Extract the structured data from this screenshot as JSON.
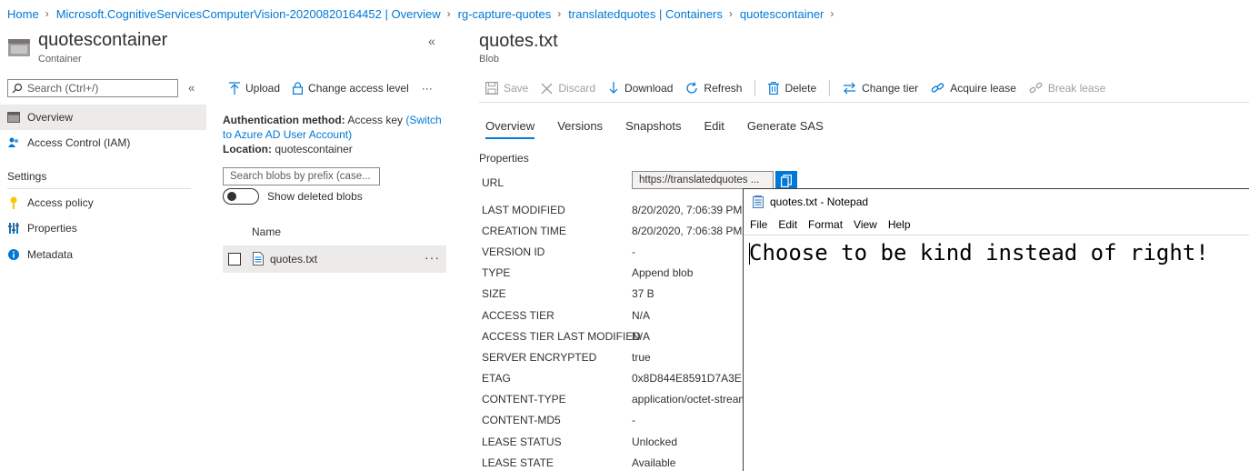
{
  "breadcrumb": [
    "Home",
    "Microsoft.CognitiveServicesComputerVision-20200820164452 | Overview",
    "rg-capture-quotes",
    "translatedquotes | Containers",
    "quotescontainer"
  ],
  "container": {
    "title": "quotescontainer",
    "subtitle": "Container"
  },
  "left_nav": {
    "search_placeholder": "Search (Ctrl+/)",
    "items": [
      {
        "label": "Overview",
        "icon": "overview-icon"
      },
      {
        "label": "Access Control (IAM)",
        "icon": "people-icon"
      }
    ],
    "settings_heading": "Settings",
    "settings_items": [
      {
        "label": "Access policy",
        "icon": "key-icon"
      },
      {
        "label": "Properties",
        "icon": "sliders-icon"
      },
      {
        "label": "Metadata",
        "icon": "info-icon"
      }
    ]
  },
  "middle": {
    "toolbar": {
      "upload": "Upload",
      "change_access": "Change access level",
      "more": "···"
    },
    "auth_label": "Authentication method:",
    "auth_value": "Access key",
    "auth_link": "(Switch to Azure AD User Account)",
    "location_label": "Location:",
    "location_value": "quotescontainer",
    "prefix_placeholder": "Search blobs by prefix (case...",
    "show_deleted": "Show deleted blobs",
    "name_header": "Name",
    "rows": [
      {
        "name": "quotes.txt"
      }
    ]
  },
  "blob": {
    "title": "quotes.txt",
    "subtitle": "Blob",
    "toolbar": {
      "save": "Save",
      "discard": "Discard",
      "download": "Download",
      "refresh": "Refresh",
      "delete": "Delete",
      "change_tier": "Change tier",
      "acquire_lease": "Acquire lease",
      "break_lease": "Break lease"
    },
    "tabs": [
      "Overview",
      "Versions",
      "Snapshots",
      "Edit",
      "Generate SAS"
    ],
    "properties_heading": "Properties",
    "url_label": "URL",
    "url_value": "https://translatedquotes ...",
    "properties": [
      {
        "label": "LAST MODIFIED",
        "value": "8/20/2020, 7:06:39 PM"
      },
      {
        "label": "CREATION TIME",
        "value": "8/20/2020, 7:06:38 PM"
      },
      {
        "label": "VERSION ID",
        "value": "-"
      },
      {
        "label": "TYPE",
        "value": "Append blob"
      },
      {
        "label": "SIZE",
        "value": "37 B"
      },
      {
        "label": "ACCESS TIER",
        "value": "N/A"
      },
      {
        "label": "ACCESS TIER LAST MODIFIED",
        "value": "N/A"
      },
      {
        "label": "SERVER ENCRYPTED",
        "value": "true"
      },
      {
        "label": "ETAG",
        "value": "0x8D844E8591D7A3E"
      },
      {
        "label": "CONTENT-TYPE",
        "value": "application/octet-stream"
      },
      {
        "label": "CONTENT-MD5",
        "value": "-"
      },
      {
        "label": "LEASE STATUS",
        "value": "Unlocked"
      },
      {
        "label": "LEASE STATE",
        "value": "Available"
      }
    ]
  },
  "notepad": {
    "title": "quotes.txt - Notepad",
    "menu": [
      "File",
      "Edit",
      "Format",
      "View",
      "Help"
    ],
    "content": "Choose to be kind instead of right!"
  },
  "colors": {
    "accent": "#0078d4",
    "selected_bg": "#edebe9"
  }
}
